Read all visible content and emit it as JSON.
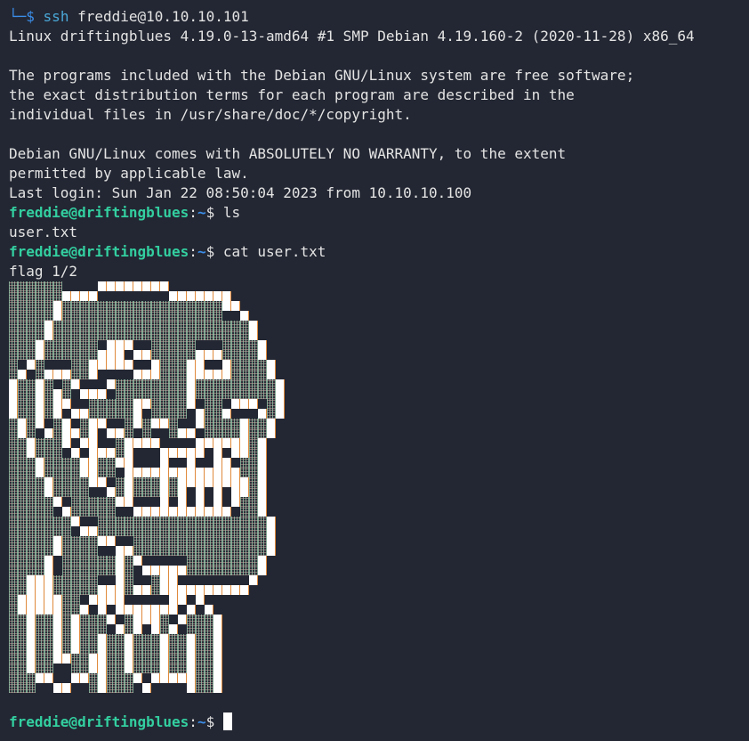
{
  "ssh_line": {
    "prompt_glyph": "└─$",
    "command": "ssh",
    "args": "freddie@10.10.10.101"
  },
  "output": {
    "uname": "Linux driftingblues 4.19.0-13-amd64 #1 SMP Debian 4.19.160-2 (2020-11-28) x86_64",
    "motd1": "The programs included with the Debian GNU/Linux system are free software;",
    "motd2": "the exact distribution terms for each program are described in the",
    "motd3": "individual files in /usr/share/doc/*/copyright.",
    "motd4": "Debian GNU/Linux comes with ABSOLUTELY NO WARRANTY, to the extent",
    "motd5": "permitted by applicable law.",
    "last_login": "Last login: Sun Jan 22 08:50:04 2023 from 10.10.10.100",
    "ls_result": "user.txt",
    "flag_text": "flag 1/2"
  },
  "prompt": {
    "user_host": "freddie@driftingblues",
    "colon": ":",
    "path": "~",
    "dollar": "$ "
  },
  "commands": {
    "ls": "ls",
    "cat": "cat user.txt"
  },
  "ascii_art": [
    "SSSSSS....WWWWWWWW.............",
    "SSSSSSWWWW........WWWWWWW......",
    "SSSSSWSSSSSSSSSSSSSSSSSSWW.....",
    "SSSSSWSSSSSSSSSSSSSSSSSS..W....",
    "SSSSWSSSSSSSSSSSSSSSSSSSSSSW...",
    "SSSSWSSSSSSSSSSSSSSSSSSSSSSW...",
    "SSSWSSSSSS.WWW..SSSSS...SSSSW..",
    "SSSWSSSSSSWWW.WWSSSSSWWWSSSSW..",
    "S.WS...SSWWWWW..WSSSWW..WSSSSW.",
    "SW.SWWWSSW....WWWSSSWWWWWSSSSW.",
    "WSSWS.SW...WSSSSSSSSWSSSSSSSSSW",
    "WSSWSWS.WWW.SSSSSSSSWSSSSSSSSSW",
    "WSSWSWW..SSSSSWWSSSSW.SS.WWW.SW",
    "WSSWSW.WWSSSSSW.SSSS.WSSW...WSW",
    "SWSW.SW.SWW..SWSWWS..WSSSSWSSW.",
    "SWS.WSWWSW.WWS.S..SWW.SSSSWSSW.",
    "SSWSSSW.WW..SWWWW....WWWWWWSW..",
    "SSWSSS.W.WWWSW...WWWWW.W.WWSW..",
    "SSSWSSSSWWSSWW...W..W..WW.SSW..",
    "SSSWSSSSWWSS.WWWWWWWWWWWWWSSW..",
    "SSSSWSSSSWW.SWSSSWSWWWWWWWWSW..",
    "SSSSWSSSS..WSWSSSWSW.W.W.WWSW..",
    "SSSSSW.SSSSSWW...W.W.W.W.WSSW..",
    "SSSSS.WSSSSS..WWWWWWWWWWW.SSW..",
    "SSSSSSSW..SSSSSSSSSSSSSSSSSSSW.",
    "SSSSSSS.WWSSSSSSSSSSSSSSSSSSSW.",
    "SSSSSWSSSSWW..SSSSSSSSSSSSSSSW.",
    "SSSSSWSSSS..WWSSSSSSSSSSSSSSSW.",
    "SSSSW.SSSSSSWSW.....SSSSSSSSW..",
    "SSSSW.SSSSSSWS.WWWWWSSSSSSSSW..",
    "SSWWWSSSSS..WS..SWW........W...",
    "SSWWWSSSSSWWWSWWSWWWWWWWWWW....",
    "SWWWWWSS.WWWW.....WW.W.........",
    "SWWWWWSSW.W.WWWWWWW.W.W........",
    "SSWSSWSWSSSW.SWWWS.WSSSW.......",
    "SSWSSWSWSSS.WSW.WSW.SSSW.......",
    "SSWSSWSWSSWSSWSSSWSSWSSW.......",
    "SSWSSWSWSSWSSWSSSWSSWSSW.......",
    "SSWSSWWSSWWSSWSSSWSSWSSW.......",
    "SSWSS..SSWWSSWSSSWSSWSSW.......",
    "SSSWW..WWSWSSSW.WWWWWSSW.......",
    "SSS..WW..SWSSS.W....WSSW......."
  ],
  "colors": {
    "background": "#232733",
    "prompt_user": "#33cfa0",
    "prompt_path": "#3b8eea",
    "text": "#e4e4e4"
  }
}
